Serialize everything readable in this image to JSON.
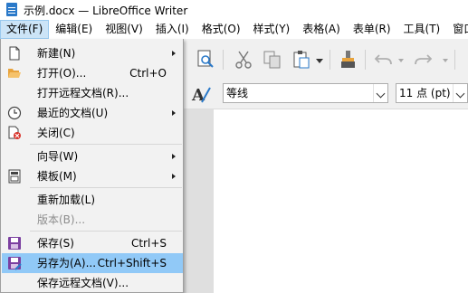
{
  "window": {
    "title": "示例.docx — LibreOffice Writer"
  },
  "menubar": {
    "items": [
      {
        "label": "文件(F)",
        "active": true
      },
      {
        "label": "编辑(E)"
      },
      {
        "label": "视图(V)"
      },
      {
        "label": "插入(I)"
      },
      {
        "label": "格式(O)"
      },
      {
        "label": "样式(Y)"
      },
      {
        "label": "表格(A)"
      },
      {
        "label": "表单(R)"
      },
      {
        "label": "工具(T)"
      },
      {
        "label": "窗口"
      }
    ]
  },
  "formatting_bar": {
    "font_name": "等线",
    "font_size": "11 点 (pt)"
  },
  "file_menu": {
    "items": [
      {
        "label": "新建(N)",
        "icon": "new-document-icon",
        "submenu": true
      },
      {
        "label": "打开(O)...",
        "icon": "open-folder-icon",
        "shortcut": "Ctrl+O"
      },
      {
        "label": "打开远程文档(R)...",
        "icon": ""
      },
      {
        "label": "最近的文档(U)",
        "icon": "clock-icon",
        "submenu": true
      },
      {
        "label": "关闭(C)",
        "icon": "close-document-icon"
      },
      {
        "label": "向导(W)",
        "icon": "",
        "submenu": true
      },
      {
        "label": "模板(M)",
        "icon": "template-icon",
        "submenu": true
      },
      {
        "label": "重新加载(L)",
        "icon": ""
      },
      {
        "label": "版本(B)...",
        "icon": "",
        "disabled": true
      },
      {
        "label": "保存(S)",
        "icon": "save-icon",
        "shortcut": "Ctrl+S"
      },
      {
        "label": "另存为(A)...",
        "icon": "save-as-icon",
        "shortcut": "Ctrl+Shift+S",
        "highlighted": true
      },
      {
        "label": "保存远程文档(V)...",
        "icon": ""
      }
    ]
  },
  "colors": {
    "highlight": "#91c9f7",
    "menubar_active": "#cce4f7",
    "save_icon": "#7b3fa0"
  }
}
